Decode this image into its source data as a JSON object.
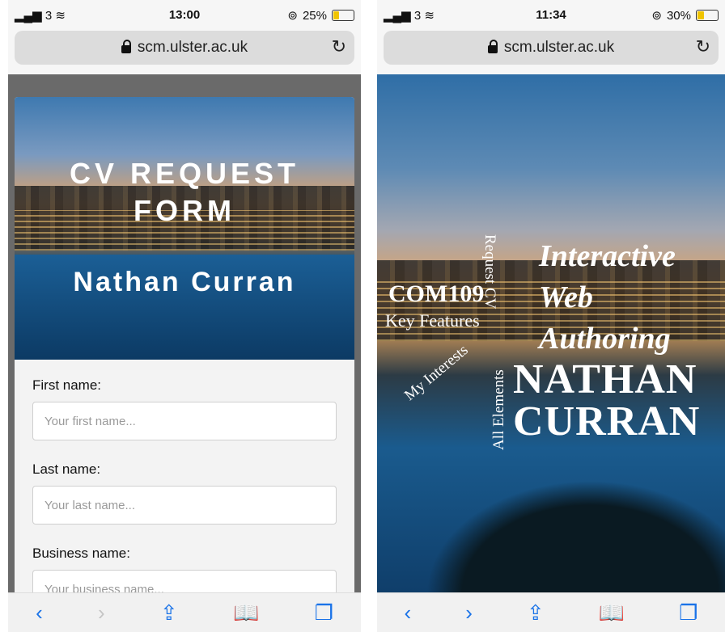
{
  "left": {
    "status": {
      "signal": "3",
      "time": "13:00",
      "battery": "25%"
    },
    "url": "scm.ulster.ac.uk",
    "hero": {
      "title": "CV REQUEST FORM",
      "name": "Nathan Curran"
    },
    "form": {
      "fields": [
        {
          "label": "First name:",
          "placeholder": "Your first name..."
        },
        {
          "label": "Last name:",
          "placeholder": "Your last name..."
        },
        {
          "label": "Business name:",
          "placeholder": "Your business name..."
        }
      ]
    }
  },
  "right": {
    "status": {
      "signal": "3",
      "time": "11:34",
      "battery": "30%"
    },
    "url": "scm.ulster.ac.uk",
    "hero": {
      "heading_line1": "Interactive",
      "heading_line2": "Web",
      "heading_line3": "Authoring",
      "name_line1": "NATHAN",
      "name_line2": "CURRAN",
      "course": "COM109",
      "nav": {
        "key_features": "Key Features",
        "request_cv": "Request CV",
        "my_interests": "My Interests",
        "all_elements": "All Elements"
      }
    }
  },
  "toolbar_icons": [
    "back-icon",
    "forward-icon",
    "share-icon",
    "bookmarks-icon",
    "tabs-icon"
  ],
  "colors": {
    "accent": "#1a73e8",
    "battery": "#f0c400"
  }
}
